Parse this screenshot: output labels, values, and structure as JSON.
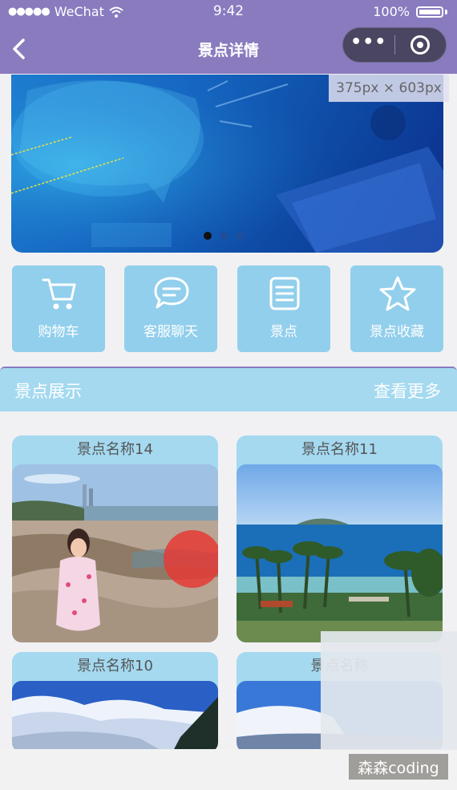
{
  "status_bar": {
    "carrier": "WeChat",
    "time": "9:42",
    "battery": "100%"
  },
  "navbar": {
    "title": "景点详情"
  },
  "banner": {
    "size_tag": "375px × 603px",
    "indicator_count": 3,
    "active_index": 0
  },
  "menu": [
    {
      "label": "购物车",
      "icon": "cart-icon"
    },
    {
      "label": "客服聊天",
      "icon": "chat-icon"
    },
    {
      "label": "景点",
      "icon": "notepad-icon"
    },
    {
      "label": "景点收藏",
      "icon": "star-icon"
    }
  ],
  "section": {
    "title": "景点展示",
    "more": "查看更多"
  },
  "spots": [
    {
      "name": "景点名称14"
    },
    {
      "name": "景点名称11"
    },
    {
      "name": "景点名称10"
    },
    {
      "name": "景点名称"
    }
  ],
  "watermark": "森森coding",
  "colors": {
    "nav": "#8a7bbf",
    "menu": "#92cfec",
    "section": "#a4d9f0"
  }
}
